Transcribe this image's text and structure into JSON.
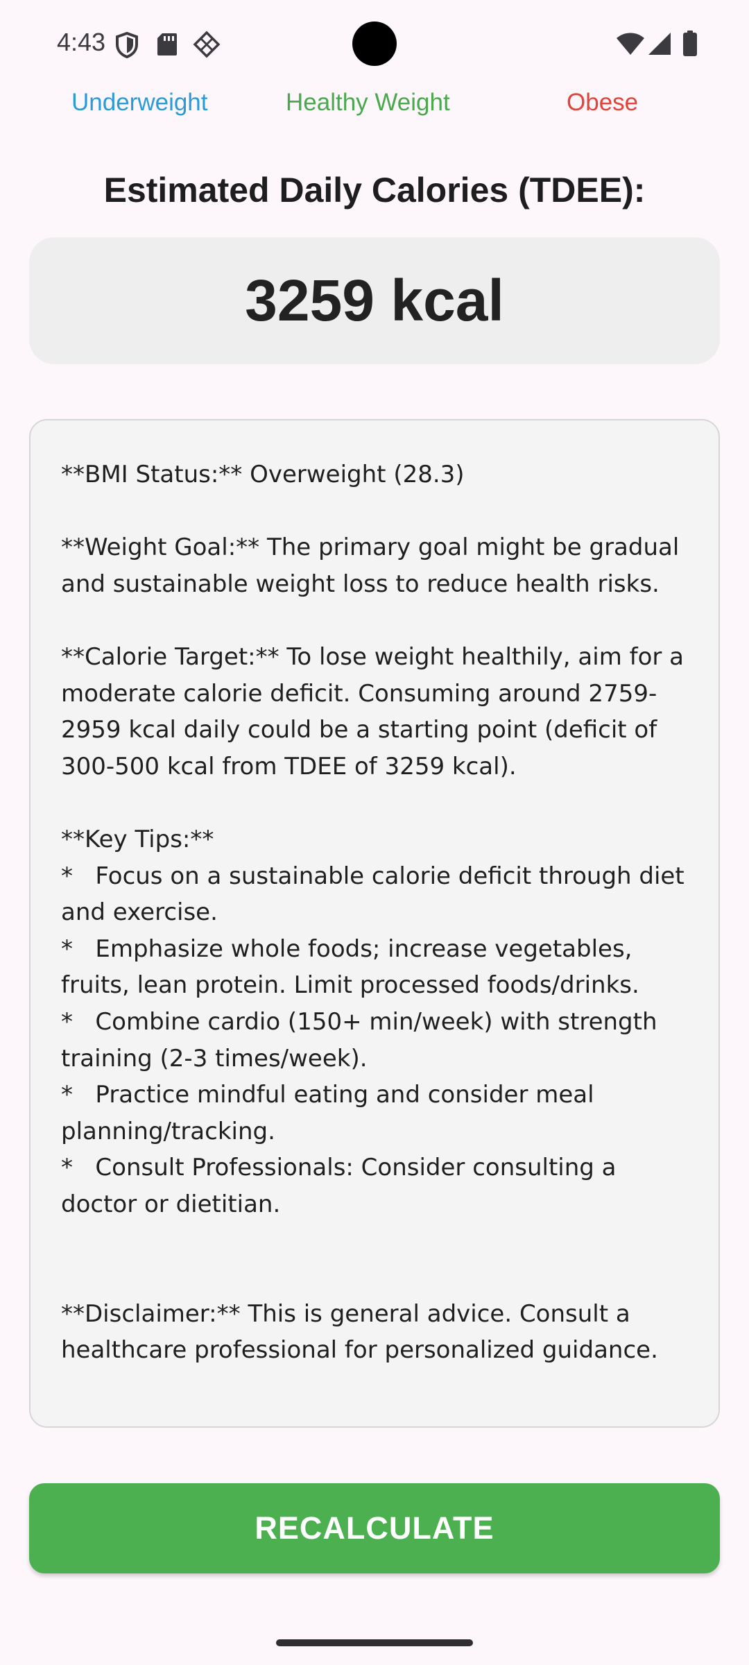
{
  "status_bar": {
    "time": "4:43",
    "icons": [
      "shield-icon",
      "sd-card-icon",
      "diamond-grid-icon",
      "wifi-icon",
      "cell-signal-icon",
      "battery-icon"
    ]
  },
  "legend": {
    "underweight": "Underweight",
    "healthy": "Healthy Weight",
    "obese": "Obese"
  },
  "colors": {
    "underweight": "#2a9bd6",
    "healthy": "#4aa84e",
    "obese": "#e0443a",
    "button": "#4caf50"
  },
  "tdee": {
    "title": "Estimated Daily Calories (TDEE):",
    "value": "3259 kcal"
  },
  "advice": {
    "text": "**BMI Status:** Overweight (28.3)\n\n**Weight Goal:** The primary goal might be gradual and sustainable weight loss to reduce health risks.\n\n**Calorie Target:** To lose weight healthily, aim for a moderate calorie deficit. Consuming around 2759-2959 kcal daily could be a starting point (deficit of 300-500 kcal from TDEE of 3259 kcal).\n\n**Key Tips:**\n*   Focus on a sustainable calorie deficit through diet and exercise.\n*   Emphasize whole foods; increase vegetables, fruits, lean protein. Limit processed foods/drinks.\n*   Combine cardio (150+ min/week) with strength training (2-3 times/week).\n*   Practice mindful eating and consider meal planning/tracking.\n*   Consult Professionals: Consider consulting a doctor or dietitian.\n\n\n**Disclaimer:** This is general advice. Consult a healthcare professional for personalized guidance."
  },
  "actions": {
    "recalculate": "RECALCULATE"
  }
}
